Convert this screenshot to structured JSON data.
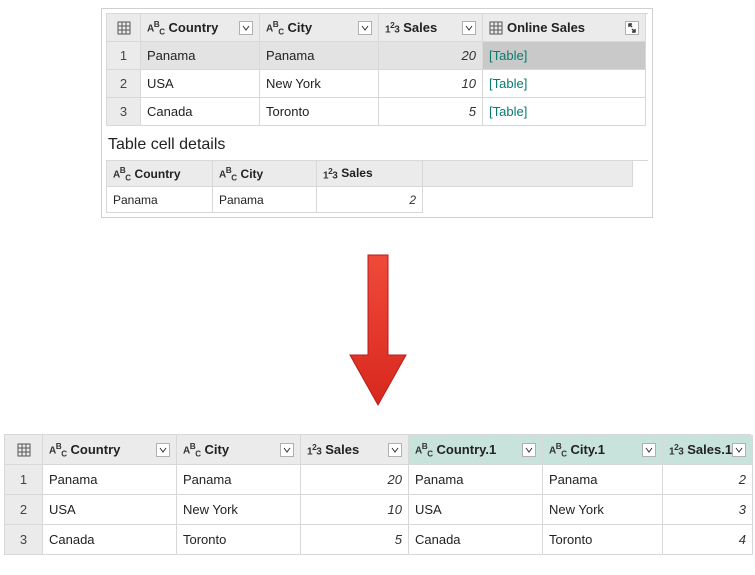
{
  "top": {
    "columns": {
      "c1": "Country",
      "c2": "City",
      "c3": "Sales",
      "c4": "Online Sales"
    },
    "rows": [
      {
        "n": "1",
        "country": "Panama",
        "city": "Panama",
        "sales": "20",
        "table": "[Table]",
        "selected": true
      },
      {
        "n": "2",
        "country": "USA",
        "city": "New York",
        "sales": "10",
        "table": "[Table]"
      },
      {
        "n": "3",
        "country": "Canada",
        "city": "Toronto",
        "sales": "5",
        "table": "[Table]"
      }
    ],
    "detail_title": "Table cell details",
    "detail_cols": {
      "c1": "Country",
      "c2": "City",
      "c3": "Sales"
    },
    "detail_row": {
      "country": "Panama",
      "city": "Panama",
      "sales": "2"
    }
  },
  "bottom": {
    "columns": {
      "c1": "Country",
      "c2": "City",
      "c3": "Sales",
      "c4": "Country.1",
      "c5": "City.1",
      "c6": "Sales.1"
    },
    "rows": [
      {
        "n": "1",
        "country": "Panama",
        "city": "Panama",
        "sales": "20",
        "country1": "Panama",
        "city1": "Panama",
        "sales1": "2"
      },
      {
        "n": "2",
        "country": "USA",
        "city": "New York",
        "sales": "10",
        "country1": "USA",
        "city1": "New York",
        "sales1": "3"
      },
      {
        "n": "3",
        "country": "Canada",
        "city": "Toronto",
        "sales": "5",
        "country1": "Canada",
        "city1": "Toronto",
        "sales1": "4"
      }
    ]
  },
  "chart_data": {
    "type": "table",
    "tables": [
      {
        "name": "source",
        "columns": [
          "Country",
          "City",
          "Sales",
          "Online Sales"
        ],
        "column_types": [
          "text",
          "text",
          "number",
          "table"
        ],
        "rows": [
          {
            "Country": "Panama",
            "City": "Panama",
            "Sales": 20,
            "Online Sales": "[Table]"
          },
          {
            "Country": "USA",
            "City": "New York",
            "Sales": 10,
            "Online Sales": "[Table]"
          },
          {
            "Country": "Canada",
            "City": "Toronto",
            "Sales": 5,
            "Online Sales": "[Table]"
          }
        ]
      },
      {
        "name": "nested_detail_row1",
        "title": "Table cell details",
        "columns": [
          "Country",
          "City",
          "Sales"
        ],
        "column_types": [
          "text",
          "text",
          "number"
        ],
        "rows": [
          {
            "Country": "Panama",
            "City": "Panama",
            "Sales": 2
          }
        ]
      },
      {
        "name": "expanded_result",
        "columns": [
          "Country",
          "City",
          "Sales",
          "Country.1",
          "City.1",
          "Sales.1"
        ],
        "column_types": [
          "text",
          "text",
          "number",
          "text",
          "text",
          "number"
        ],
        "rows": [
          {
            "Country": "Panama",
            "City": "Panama",
            "Sales": 20,
            "Country.1": "Panama",
            "City.1": "Panama",
            "Sales.1": 2
          },
          {
            "Country": "USA",
            "City": "New York",
            "Sales": 10,
            "Country.1": "USA",
            "City.1": "New York",
            "Sales.1": 3
          },
          {
            "Country": "Canada",
            "City": "Toronto",
            "Sales": 5,
            "Country.1": "Canada",
            "City.1": "Toronto",
            "Sales.1": 4
          }
        ]
      }
    ]
  }
}
